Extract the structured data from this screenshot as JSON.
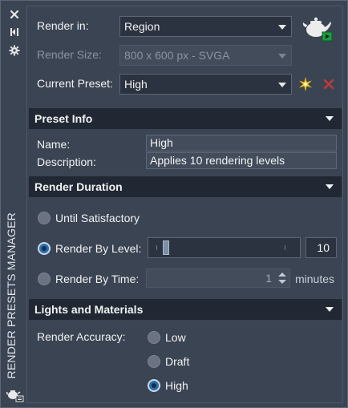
{
  "palette": {
    "title": "RENDER PRESETS MANAGER"
  },
  "top": {
    "render_in": {
      "label": "Render in:",
      "value": "Region"
    },
    "render_size": {
      "label": "Render Size:",
      "value": "800 x 600 px - SVGA"
    },
    "current_preset": {
      "label": "Current Preset:",
      "value": "High"
    }
  },
  "preset_info": {
    "header": "Preset Info",
    "name": {
      "label": "Name:",
      "value": "High"
    },
    "description": {
      "label": "Description:",
      "value": "Applies 10 rendering levels"
    }
  },
  "render_duration": {
    "header": "Render Duration",
    "until_satisfactory": "Until Satisfactory",
    "by_level": {
      "label": "Render By Level:",
      "value": "10"
    },
    "by_time": {
      "label": "Render By Time:",
      "value": "1",
      "unit": "minutes"
    }
  },
  "lights_materials": {
    "header": "Lights and Materials",
    "accuracy_label": "Render Accuracy:",
    "options": [
      "Low",
      "Draft",
      "High"
    ],
    "selected": "High"
  },
  "icons": {
    "close": "close-icon",
    "autohide": "autohide-icon",
    "properties": "gear-icon",
    "render": "teapot-render-icon",
    "new_preset": "sparkle-new-icon",
    "delete_preset": "delete-x-icon"
  },
  "colors": {
    "background": "#3b4453",
    "header_bg": "#212833",
    "radio_selected": "#2b6ea8",
    "delete_red": "#c0393b",
    "sparkle": "#f4c21b",
    "play_green": "#22b24c"
  }
}
